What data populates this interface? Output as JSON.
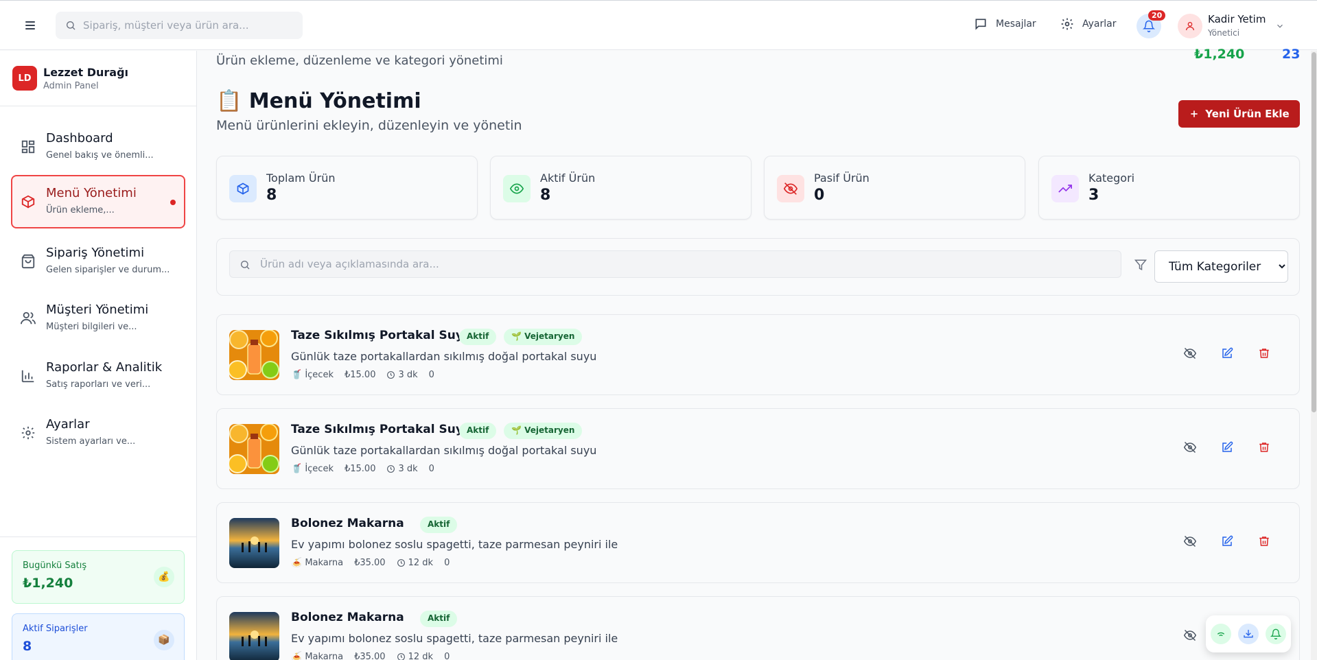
{
  "topbar": {
    "search_placeholder": "Sipariş, müşteri veya ürün ara...",
    "messages_label": "Mesajlar",
    "settings_label": "Ayarlar",
    "notification_count": "20",
    "user_name": "Kadir Yetim",
    "user_role": "Yönetici"
  },
  "brand": {
    "logo": "LD",
    "name": "Lezzet Durağı",
    "subtitle": "Admin Panel"
  },
  "sidebar": {
    "items": [
      {
        "title": "Dashboard",
        "subtitle": "Genel bakış ve önemli...",
        "icon": "dashboard-icon"
      },
      {
        "title": "Menü Yönetimi",
        "subtitle": "Ürün ekleme,...",
        "icon": "box-icon",
        "active": true
      },
      {
        "title": "Sipariş Yönetimi",
        "subtitle": "Gelen siparişler ve durum...",
        "icon": "shopping-bag-icon"
      },
      {
        "title": "Müşteri Yönetimi",
        "subtitle": "Müşteri bilgileri ve...",
        "icon": "users-icon"
      },
      {
        "title": "Raporlar & Analitik",
        "subtitle": "Satış raporları ve veri...",
        "icon": "chart-icon"
      },
      {
        "title": "Ayarlar",
        "subtitle": "Sistem ayarları ve...",
        "icon": "gear-icon"
      }
    ],
    "stats": [
      {
        "label": "Bugünkü Satış",
        "value": "₺1,240",
        "icon": "💰"
      },
      {
        "label": "Aktif Siparişler",
        "value": "8",
        "icon": "📦"
      }
    ]
  },
  "header": {
    "top_subtitle": "Ürün ekleme, düzenleme ve kategori yönetimi",
    "top_revenue": "₺1,240",
    "top_orders": "23",
    "title": "📋 Menü Yönetimi",
    "subtitle": "Menü ürünlerini ekleyin, düzenleyin ve yönetin",
    "add_button": "Yeni Ürün Ekle"
  },
  "kpis": [
    {
      "label": "Toplam Ürün",
      "value": "8",
      "icon": "cube-icon",
      "color": "#2563eb",
      "bg": "#dbeafe"
    },
    {
      "label": "Aktif Ürün",
      "value": "8",
      "icon": "eye-icon",
      "color": "#16a34a",
      "bg": "#dcfce7"
    },
    {
      "label": "Pasif Ürün",
      "value": "0",
      "icon": "eye-off-icon",
      "color": "#dc2626",
      "bg": "#fee2e2"
    },
    {
      "label": "Kategori",
      "value": "3",
      "icon": "trending-up-icon",
      "color": "#9333ea",
      "bg": "#f3e8ff"
    }
  ],
  "filter": {
    "search_placeholder": "Ürün adı veya açıklamasında ara...",
    "category_selected": "Tüm Kategoriler"
  },
  "products": [
    {
      "name": "Taze Sıkılmış Portakal Suyu",
      "status": "Aktif",
      "tag": "🌱 Vejetaryen",
      "description": "Günlük taze portakallardan sıkılmış doğal portakal suyu",
      "category": "🥤 İçecek",
      "price": "₺15.00",
      "time": "3 dk",
      "count": "0",
      "image": "orange"
    },
    {
      "name": "Taze Sıkılmış Portakal Suyu",
      "status": "Aktif",
      "tag": "🌱 Vejetaryen",
      "description": "Günlük taze portakallardan sıkılmış doğal portakal suyu",
      "category": "🥤 İçecek",
      "price": "₺15.00",
      "time": "3 dk",
      "count": "0",
      "image": "orange"
    },
    {
      "name": "Bolonez Makarna",
      "status": "Aktif",
      "tag": "",
      "description": "Ev yapımı bolonez soslu spagetti, taze parmesan peyniri ile",
      "category": "🍝 Makarna",
      "price": "₺35.00",
      "time": "12 dk",
      "count": "0",
      "image": "sunset"
    },
    {
      "name": "Bolonez Makarna",
      "status": "Aktif",
      "tag": "",
      "description": "Ev yapımı bolonez soslu spagetti, taze parmesan peyniri ile",
      "category": "🍝 Makarna",
      "price": "₺35.00",
      "time": "12 dk",
      "count": "0",
      "image": "sunset"
    }
  ],
  "colors": {
    "brand": "#dc2626",
    "primary_button": "#b91c1c",
    "active_badge_bg": "#dcfce7",
    "revenue": "#16a34a",
    "orders": "#2563eb"
  }
}
